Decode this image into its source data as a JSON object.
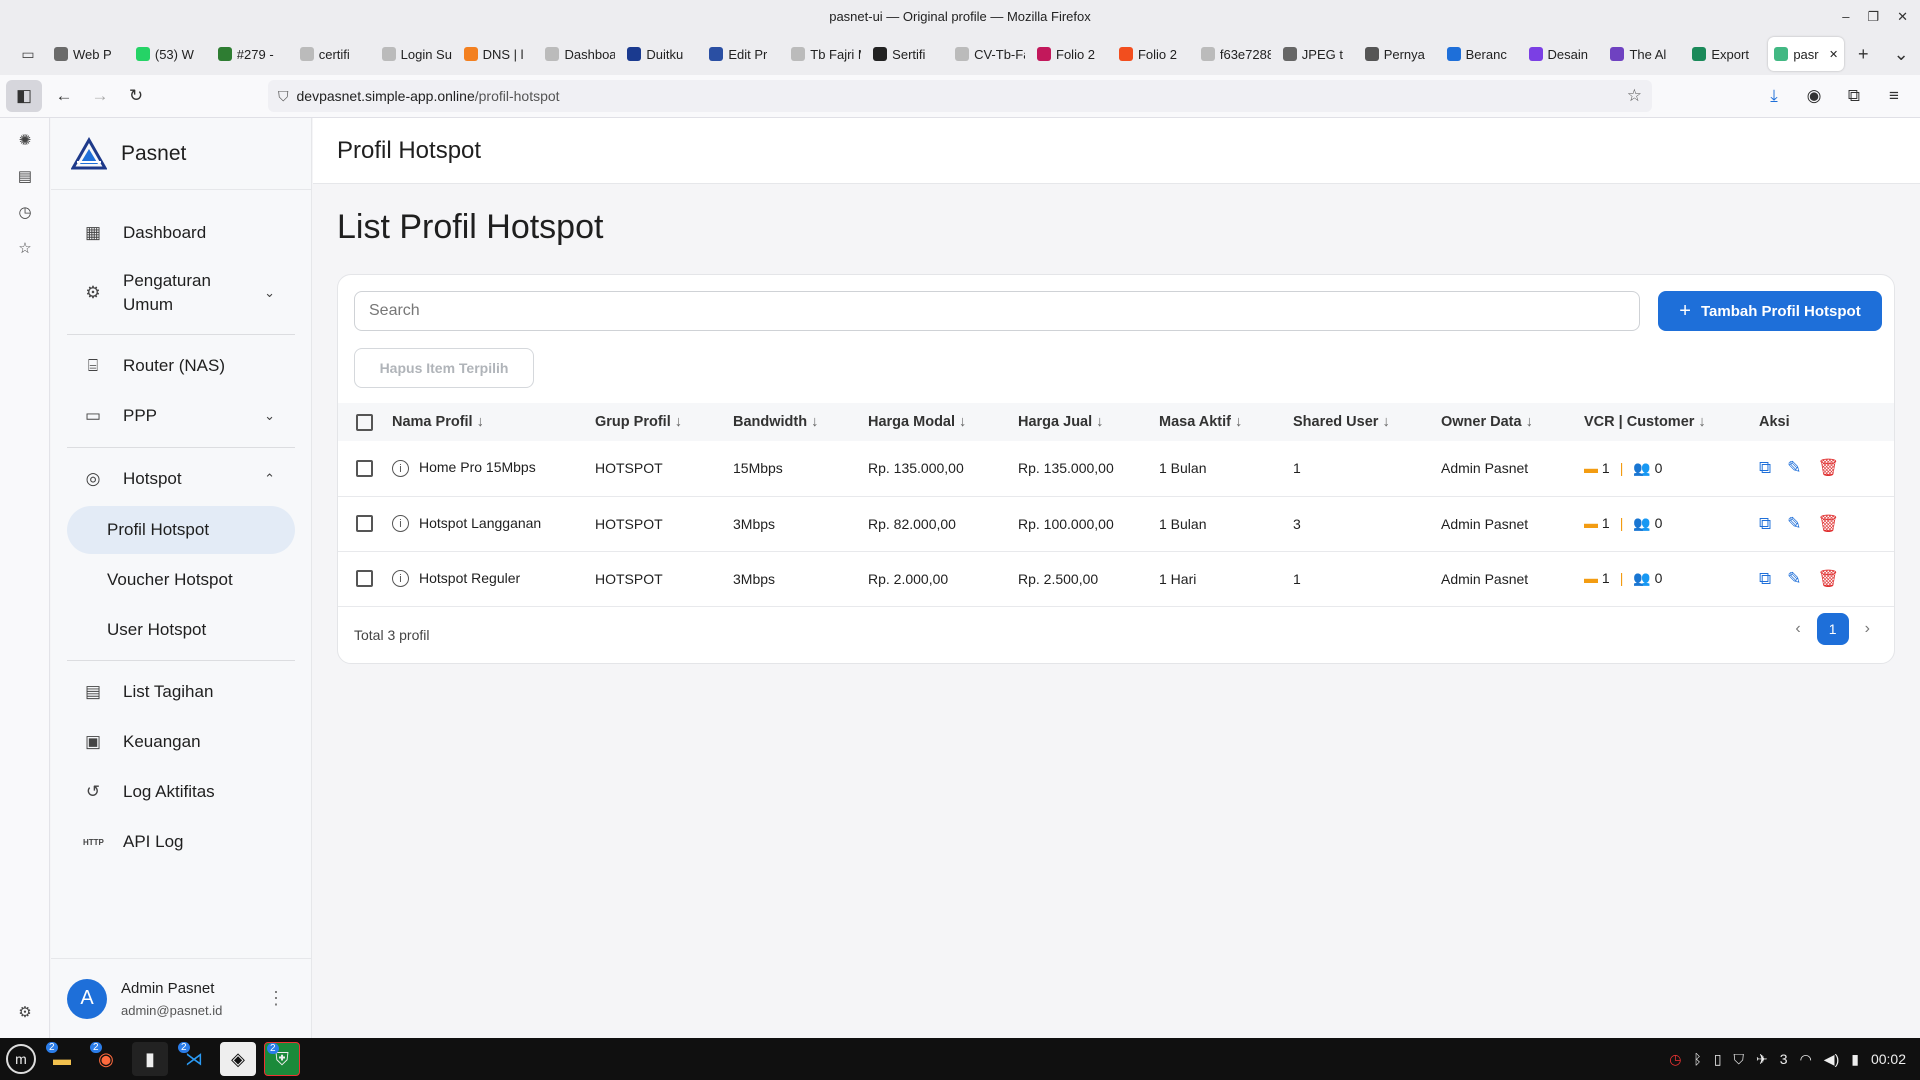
{
  "browser": {
    "window_title": "pasnet-ui — Original profile — Mozilla Firefox",
    "tabs": [
      {
        "label": "Web P",
        "color": "#6a6a6a"
      },
      {
        "label": "(53) W",
        "color": "#25d366"
      },
      {
        "label": "#279 -",
        "color": "#2e7d32"
      },
      {
        "label": "certifi",
        "color": "#bbbbbb"
      },
      {
        "label": "Login Sup",
        "color": "#bbbbbb"
      },
      {
        "label": "DNS | l",
        "color": "#f38020"
      },
      {
        "label": "Dashboard",
        "color": "#bbbbbb"
      },
      {
        "label": "Duitku",
        "color": "#1a3a8f"
      },
      {
        "label": "Edit Pr",
        "color": "#2a4fa3"
      },
      {
        "label": "Tb Fajri M",
        "color": "#bbbbbb"
      },
      {
        "label": "Sertifi",
        "color": "#222222"
      },
      {
        "label": "CV-Tb-Fajr",
        "color": "#bbbbbb"
      },
      {
        "label": "Folio 2",
        "color": "#c2185b"
      },
      {
        "label": "Folio 2",
        "color": "#f24e1e"
      },
      {
        "label": "f63e7288",
        "color": "#bbbbbb"
      },
      {
        "label": "JPEG t",
        "color": "#666666"
      },
      {
        "label": "Pernya",
        "color": "#555555"
      },
      {
        "label": "Beranc",
        "color": "#1e6fd9"
      },
      {
        "label": "Desain",
        "color": "#7b3fe4"
      },
      {
        "label": "The Al",
        "color": "#6f42c1"
      },
      {
        "label": "Export",
        "color": "#1b8a5a"
      },
      {
        "label": "pasr",
        "color": "#42b883",
        "active": true
      }
    ],
    "url_host": "devpasnet.simple-app.online",
    "url_path": "/profil-hotspot"
  },
  "sidebar": {
    "brand": "Pasnet",
    "items": {
      "dashboard": "Dashboard",
      "pengaturan_umum": "Pengaturan Umum",
      "router": "Router (NAS)",
      "ppp": "PPP",
      "hotspot": "Hotspot",
      "profil_hotspot": "Profil Hotspot",
      "voucher_hotspot": "Voucher Hotspot",
      "user_hotspot": "User Hotspot",
      "list_tagihan": "List Tagihan",
      "keuangan": "Keuangan",
      "log_aktifitas": "Log Aktifitas",
      "api_log": "API Log"
    },
    "user": {
      "initial": "A",
      "name": "Admin Pasnet",
      "email": "admin@pasnet.id"
    }
  },
  "header": {
    "title": "Profil Hotspot"
  },
  "main": {
    "heading": "List Profil Hotspot",
    "search_placeholder": "Search",
    "add_button": "Tambah Profil Hotspot",
    "delete_selected": "Hapus Item Terpilih",
    "columns": [
      "Nama Profil",
      "Grup Profil",
      "Bandwidth",
      "Harga Modal",
      "Harga Jual",
      "Masa Aktif",
      "Shared User",
      "Owner Data",
      "VCR | Customer",
      "Aksi"
    ],
    "rows": [
      {
        "name": "Home Pro 15Mbps",
        "group": "HOTSPOT",
        "bandwidth": "15Mbps",
        "modal": "Rp. 135.000,00",
        "jual": "Rp. 135.000,00",
        "masa": "1 Bulan",
        "shared": "1",
        "owner": "Admin Pasnet",
        "vcr": "1",
        "customer": "0"
      },
      {
        "name": "Hotspot Langganan",
        "group": "HOTSPOT",
        "bandwidth": "3Mbps",
        "modal": "Rp. 82.000,00",
        "jual": "Rp. 100.000,00",
        "masa": "1 Bulan",
        "shared": "3",
        "owner": "Admin Pasnet",
        "vcr": "1",
        "customer": "0"
      },
      {
        "name": "Hotspot Reguler",
        "group": "HOTSPOT",
        "bandwidth": "3Mbps",
        "modal": "Rp. 2.000,00",
        "jual": "Rp. 2.500,00",
        "masa": "1 Hari",
        "shared": "1",
        "owner": "Admin Pasnet",
        "vcr": "1",
        "customer": "0"
      }
    ],
    "total": "Total 3 profil",
    "page": "1"
  },
  "taskbar": {
    "clock": "00:02",
    "tray_count": "3",
    "badges": [
      "2",
      "2",
      "2",
      "2"
    ]
  },
  "colors": {
    "accent": "#1e6fd9",
    "danger": "#e03131",
    "warning": "#f39c12"
  }
}
